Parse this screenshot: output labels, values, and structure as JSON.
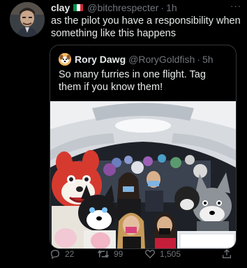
{
  "tweet": {
    "author_name": "clay",
    "author_handle": "@bitchrespecter",
    "separator": "·",
    "time": "1h",
    "more": "···",
    "text": "as the pilot you have a responsibility when something like this happens"
  },
  "quoted_tweet": {
    "author_name": "Rory Dawg",
    "author_handle": "@RoryGoldfish",
    "separator": "·",
    "time": "5h",
    "text": "So many furries in one flight. Tag them if you know them!"
  },
  "actions": {
    "reply_count": "22",
    "retweet_count": "99",
    "like_count": "1,505"
  },
  "colors": {
    "background": "#000000",
    "text": "#e7e9ea",
    "muted": "#71767b",
    "border": "#333639"
  },
  "icons": [
    "italy-flag-icon",
    "reply-icon",
    "retweet-icon",
    "like-icon",
    "share-icon",
    "more-icon"
  ]
}
